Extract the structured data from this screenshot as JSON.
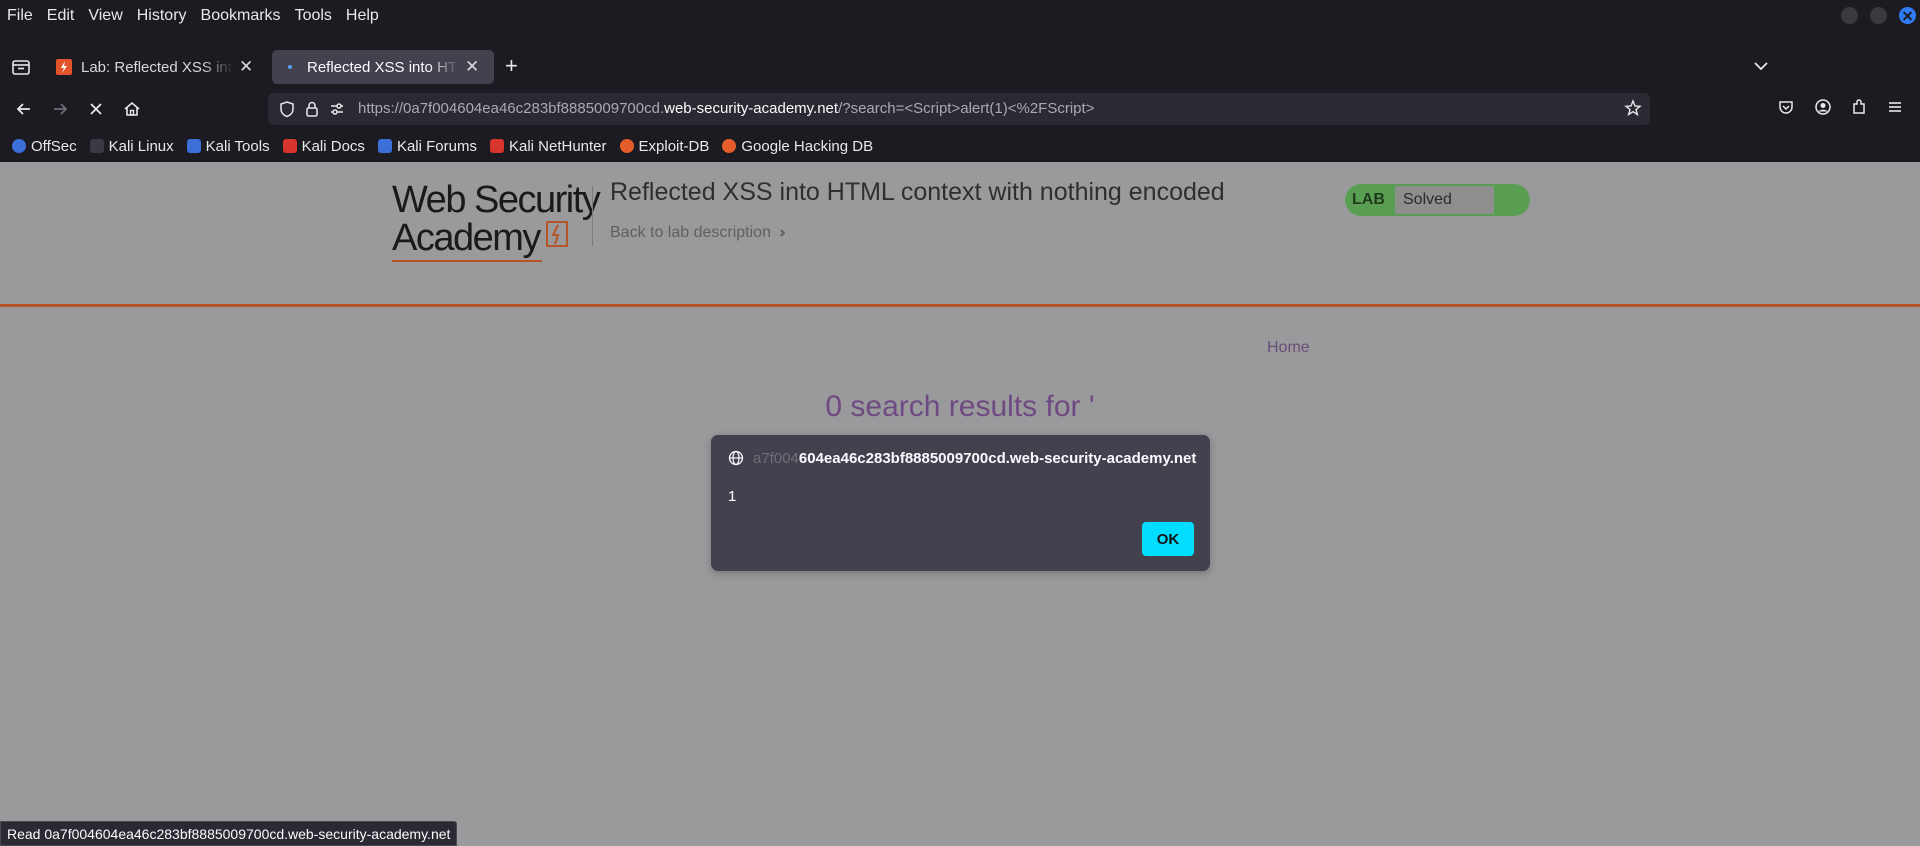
{
  "menubar": {
    "items": [
      "File",
      "Edit",
      "View",
      "History",
      "Bookmarks",
      "Tools",
      "Help"
    ]
  },
  "tabs": [
    {
      "title": "Lab: Reflected XSS into HTML context with nothing encoded",
      "active": false
    },
    {
      "title": "Reflected XSS into HTML context with nothing encoded",
      "active": true
    }
  ],
  "urlbar": {
    "url_prefix": "https://0a7f004604ea46c283bf8885009700cd.",
    "url_domain": "web-security-academy.net",
    "url_suffix": "/?search=<Script>alert(1)<%2FScript>"
  },
  "bookmarks": [
    {
      "label": "OffSec",
      "color": "#3d6fd8"
    },
    {
      "label": "Kali Linux",
      "color": "#1c1b22"
    },
    {
      "label": "Kali Tools",
      "color": "#3d6fd8"
    },
    {
      "label": "Kali Docs",
      "color": "#d7352b"
    },
    {
      "label": "Kali Forums",
      "color": "#3d6fd8"
    },
    {
      "label": "Kali NetHunter",
      "color": "#d7352b"
    },
    {
      "label": "Exploit-DB",
      "color": "#e55d2a"
    },
    {
      "label": "Google Hacking DB",
      "color": "#e55d2a"
    }
  ],
  "lab": {
    "logo_line1": "Web Security",
    "logo_line2": "Academy",
    "title": "Reflected XSS into HTML context with nothing encoded",
    "back_link": "Back to lab description",
    "status_label": "LAB",
    "status_value": "Solved"
  },
  "page": {
    "home_link": "Home",
    "search_results": "0 search results for '"
  },
  "dialog": {
    "origin_faded": "a7f004",
    "origin_main": "604ea46c283bf8885009700cd.web-security-academy.net",
    "message": "1",
    "ok_label": "OK"
  },
  "statusbar": {
    "text": "Read 0a7f004604ea46c283bf8885009700cd.web-security-academy.net"
  },
  "colors": {
    "accent": "#00ddff",
    "lab_solved": "#5a9e53",
    "header_rule": "#b4552a"
  }
}
